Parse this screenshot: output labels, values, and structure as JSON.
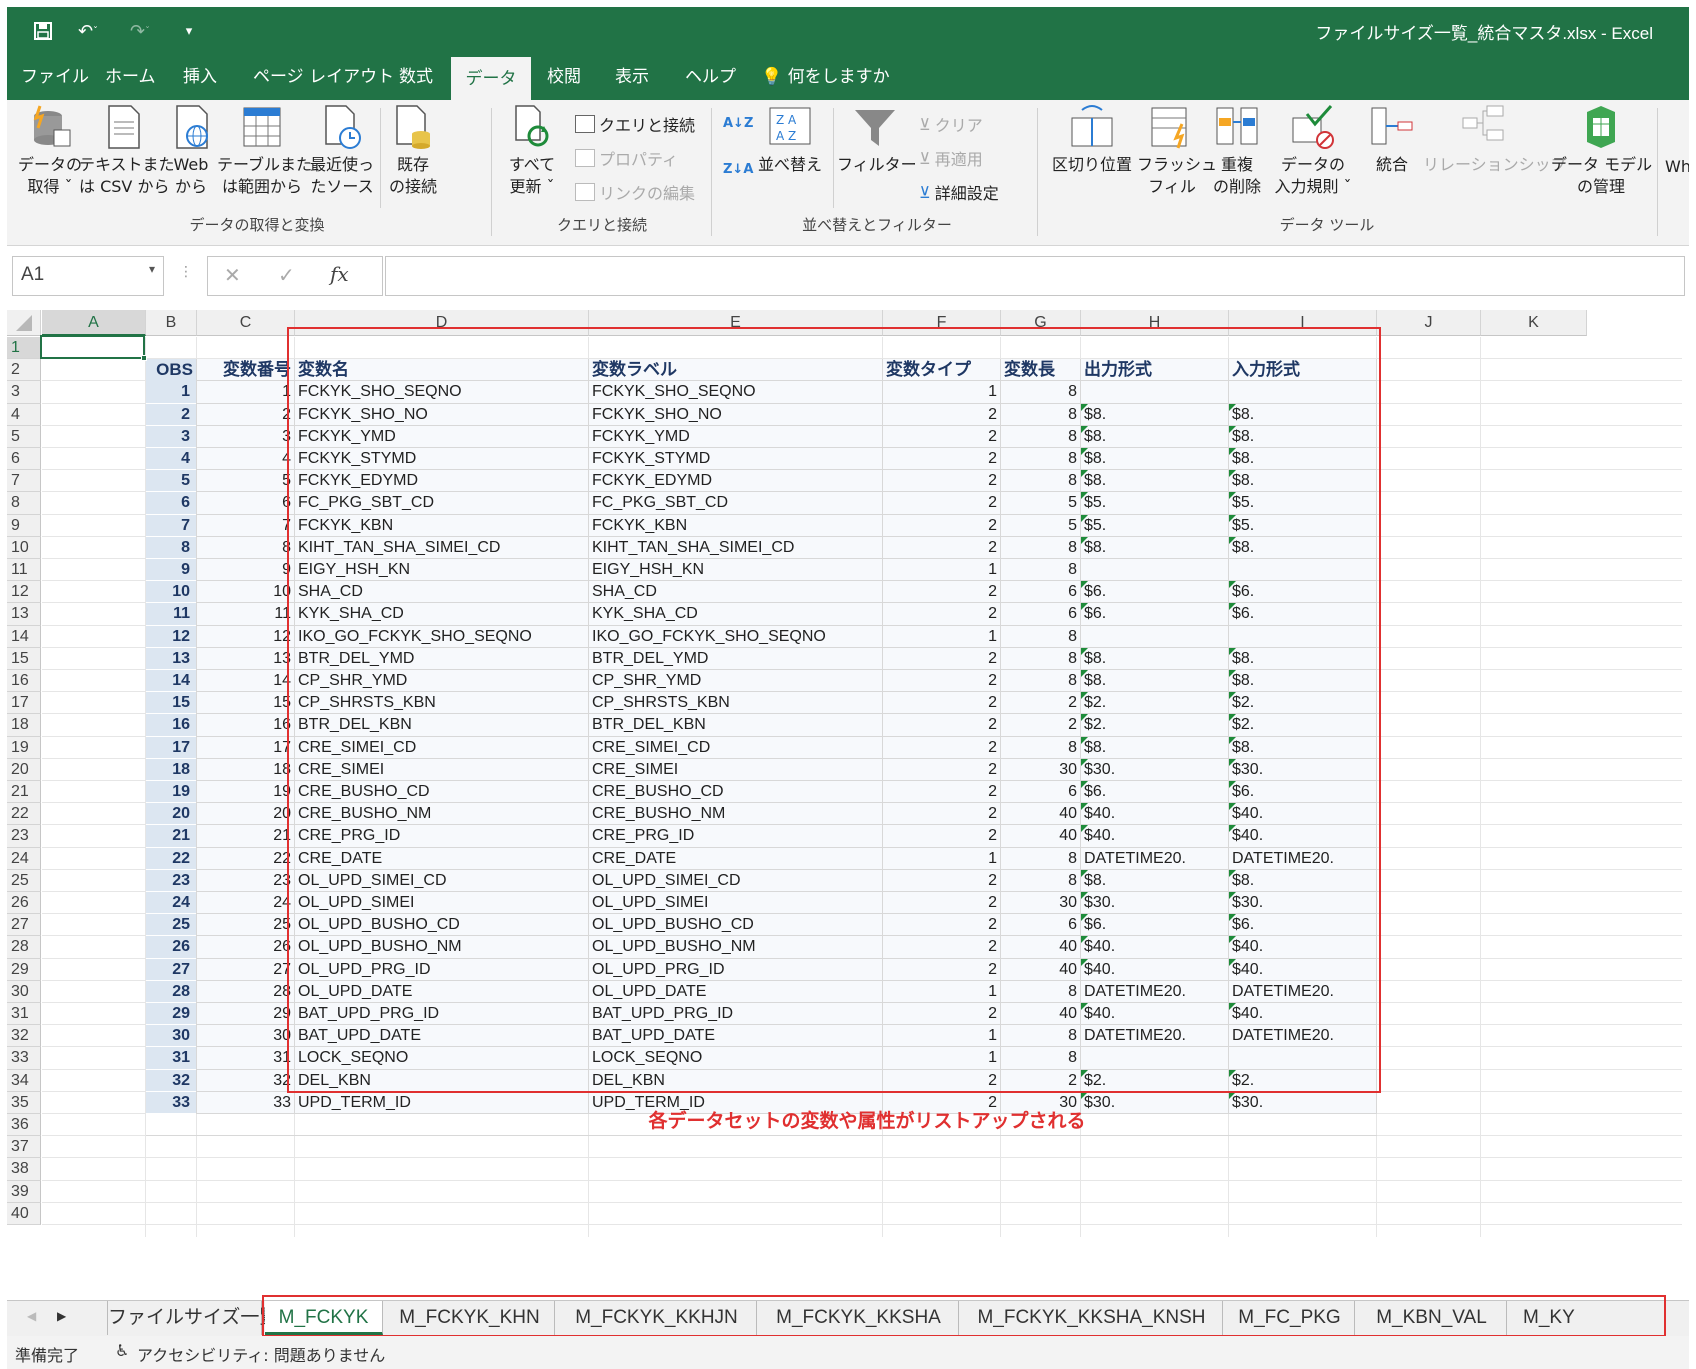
{
  "window": {
    "title": "ファイルサイズ一覧_統合マスタ.xlsx  -  Excel"
  },
  "ribbon_tabs": [
    "ファイル",
    "ホーム",
    "挿入",
    "ページ レイアウト",
    "数式",
    "データ",
    "校閲",
    "表示",
    "ヘルプ"
  ],
  "active_tab": "データ",
  "tellme": "何をしますか",
  "ribbon": {
    "get_data": [
      "データの",
      "取得 ˇ"
    ],
    "text_csv": [
      "テキストまた",
      "は CSV から"
    ],
    "web": [
      "Web",
      "から"
    ],
    "table_range": [
      "テーブルまた",
      "は範囲から"
    ],
    "recent_sources": [
      "最近使っ",
      "たソース"
    ],
    "existing_conn": [
      "既存",
      "の接続"
    ],
    "group1": "データの取得と変換",
    "refresh_all": [
      "すべて",
      "更新 ˇ"
    ],
    "queries_conn": "クエリと接続",
    "properties": "プロパティ",
    "edit_links": "リンクの編集",
    "group2": "クエリと接続",
    "sort": "並べ替え",
    "filter": "フィルター",
    "clear": "クリア",
    "reapply": "再適用",
    "advanced": "詳細設定",
    "group3": "並べ替えとフィルター",
    "text_to_columns": [
      "区切り位置"
    ],
    "flash_fill": [
      "フラッシュ",
      "フィル"
    ],
    "remove_dup": [
      "重複",
      "の削除"
    ],
    "data_validation": [
      "データの",
      "入力規則 ˇ"
    ],
    "consolidate": "統合",
    "relationships": "リレーションシップ",
    "data_model": [
      "データ モデル",
      "の管理"
    ],
    "whatif": "Wh",
    "group4": "データ ツール"
  },
  "formula_bar": {
    "name_box": "A1",
    "fx": "fx",
    "content": ""
  },
  "columns": [
    "A",
    "B",
    "C",
    "D",
    "E",
    "F",
    "G",
    "H",
    "I",
    "J",
    "K"
  ],
  "rows": [
    "1",
    "2",
    "3",
    "4",
    "5",
    "6",
    "7",
    "8",
    "9",
    "10",
    "11",
    "12",
    "13",
    "14",
    "15",
    "16",
    "17",
    "18",
    "19",
    "20",
    "21",
    "22",
    "23",
    "24",
    "25",
    "26",
    "27",
    "28",
    "29",
    "30",
    "31",
    "32",
    "33",
    "34",
    "35",
    "36",
    "37",
    "38",
    "39",
    "40"
  ],
  "table_headers": [
    "OBS",
    "変数番号",
    "変数名",
    "変数ラベル",
    "変数タイプ",
    "変数長",
    "出力形式",
    "入力形式"
  ],
  "table_rows": [
    [
      "1",
      "1",
      "FCKYK_SHO_SEQNO",
      "FCKYK_SHO_SEQNO",
      "1",
      "8",
      "",
      ""
    ],
    [
      "2",
      "2",
      "FCKYK_SHO_NO",
      "FCKYK_SHO_NO",
      "2",
      "8",
      "$8.",
      "$8."
    ],
    [
      "3",
      "3",
      "FCKYK_YMD",
      "FCKYK_YMD",
      "2",
      "8",
      "$8.",
      "$8."
    ],
    [
      "4",
      "4",
      "FCKYK_STYMD",
      "FCKYK_STYMD",
      "2",
      "8",
      "$8.",
      "$8."
    ],
    [
      "5",
      "5",
      "FCKYK_EDYMD",
      "FCKYK_EDYMD",
      "2",
      "8",
      "$8.",
      "$8."
    ],
    [
      "6",
      "6",
      "FC_PKG_SBT_CD",
      "FC_PKG_SBT_CD",
      "2",
      "5",
      "$5.",
      "$5."
    ],
    [
      "7",
      "7",
      "FCKYK_KBN",
      "FCKYK_KBN",
      "2",
      "5",
      "$5.",
      "$5."
    ],
    [
      "8",
      "8",
      "KIHT_TAN_SHA_SIMEI_CD",
      "KIHT_TAN_SHA_SIMEI_CD",
      "2",
      "8",
      "$8.",
      "$8."
    ],
    [
      "9",
      "9",
      "EIGY_HSH_KN",
      "EIGY_HSH_KN",
      "1",
      "8",
      "",
      ""
    ],
    [
      "10",
      "10",
      "SHA_CD",
      "SHA_CD",
      "2",
      "6",
      "$6.",
      "$6."
    ],
    [
      "11",
      "11",
      "KYK_SHA_CD",
      "KYK_SHA_CD",
      "2",
      "6",
      "$6.",
      "$6."
    ],
    [
      "12",
      "12",
      "IKO_GO_FCKYK_SHO_SEQNO",
      "IKO_GO_FCKYK_SHO_SEQNO",
      "1",
      "8",
      "",
      ""
    ],
    [
      "13",
      "13",
      "BTR_DEL_YMD",
      "BTR_DEL_YMD",
      "2",
      "8",
      "$8.",
      "$8."
    ],
    [
      "14",
      "14",
      "CP_SHR_YMD",
      "CP_SHR_YMD",
      "2",
      "8",
      "$8.",
      "$8."
    ],
    [
      "15",
      "15",
      "CP_SHRSTS_KBN",
      "CP_SHRSTS_KBN",
      "2",
      "2",
      "$2.",
      "$2."
    ],
    [
      "16",
      "16",
      "BTR_DEL_KBN",
      "BTR_DEL_KBN",
      "2",
      "2",
      "$2.",
      "$2."
    ],
    [
      "17",
      "17",
      "CRE_SIMEI_CD",
      "CRE_SIMEI_CD",
      "2",
      "8",
      "$8.",
      "$8."
    ],
    [
      "18",
      "18",
      "CRE_SIMEI",
      "CRE_SIMEI",
      "2",
      "30",
      "$30.",
      "$30."
    ],
    [
      "19",
      "19",
      "CRE_BUSHO_CD",
      "CRE_BUSHO_CD",
      "2",
      "6",
      "$6.",
      "$6."
    ],
    [
      "20",
      "20",
      "CRE_BUSHO_NM",
      "CRE_BUSHO_NM",
      "2",
      "40",
      "$40.",
      "$40."
    ],
    [
      "21",
      "21",
      "CRE_PRG_ID",
      "CRE_PRG_ID",
      "2",
      "40",
      "$40.",
      "$40."
    ],
    [
      "22",
      "22",
      "CRE_DATE",
      "CRE_DATE",
      "1",
      "8",
      "DATETIME20.",
      "DATETIME20."
    ],
    [
      "23",
      "23",
      "OL_UPD_SIMEI_CD",
      "OL_UPD_SIMEI_CD",
      "2",
      "8",
      "$8.",
      "$8."
    ],
    [
      "24",
      "24",
      "OL_UPD_SIMEI",
      "OL_UPD_SIMEI",
      "2",
      "30",
      "$30.",
      "$30."
    ],
    [
      "25",
      "25",
      "OL_UPD_BUSHO_CD",
      "OL_UPD_BUSHO_CD",
      "2",
      "6",
      "$6.",
      "$6."
    ],
    [
      "26",
      "26",
      "OL_UPD_BUSHO_NM",
      "OL_UPD_BUSHO_NM",
      "2",
      "40",
      "$40.",
      "$40."
    ],
    [
      "27",
      "27",
      "OL_UPD_PRG_ID",
      "OL_UPD_PRG_ID",
      "2",
      "40",
      "$40.",
      "$40."
    ],
    [
      "28",
      "28",
      "OL_UPD_DATE",
      "OL_UPD_DATE",
      "1",
      "8",
      "DATETIME20.",
      "DATETIME20."
    ],
    [
      "29",
      "29",
      "BAT_UPD_PRG_ID",
      "BAT_UPD_PRG_ID",
      "2",
      "40",
      "$40.",
      "$40."
    ],
    [
      "30",
      "30",
      "BAT_UPD_DATE",
      "BAT_UPD_DATE",
      "1",
      "8",
      "DATETIME20.",
      "DATETIME20."
    ],
    [
      "31",
      "31",
      "LOCK_SEQNO",
      "LOCK_SEQNO",
      "1",
      "8",
      "",
      ""
    ],
    [
      "32",
      "32",
      "DEL_KBN",
      "DEL_KBN",
      "2",
      "2",
      "$2.",
      "$2."
    ],
    [
      "33",
      "33",
      "UPD_TERM_ID",
      "UPD_TERM_ID",
      "2",
      "30",
      "$30.",
      "$30."
    ]
  ],
  "annotation": "各データセットの変数や属性がリストアップされる",
  "sheet_tabs": [
    "ファイルサイズ一覧",
    "M_FCKYK",
    "M_FCKYK_KHN",
    "M_FCKYK_KKHJN",
    "M_FCKYK_KKSHA",
    "M_FCKYK_KKSHA_KNSH",
    "M_FC_PKG",
    "M_KBN_VAL",
    "M_KY"
  ],
  "active_sheet": "M_FCKYK",
  "status": {
    "ready": "準備完了",
    "accessibility": "アクセシビリティ: 問題ありません"
  },
  "colors": {
    "excel_green": "#217346",
    "annotation_red": "#e03030",
    "obs_fill": "#dce6f1",
    "header_text": "#1f3864"
  }
}
